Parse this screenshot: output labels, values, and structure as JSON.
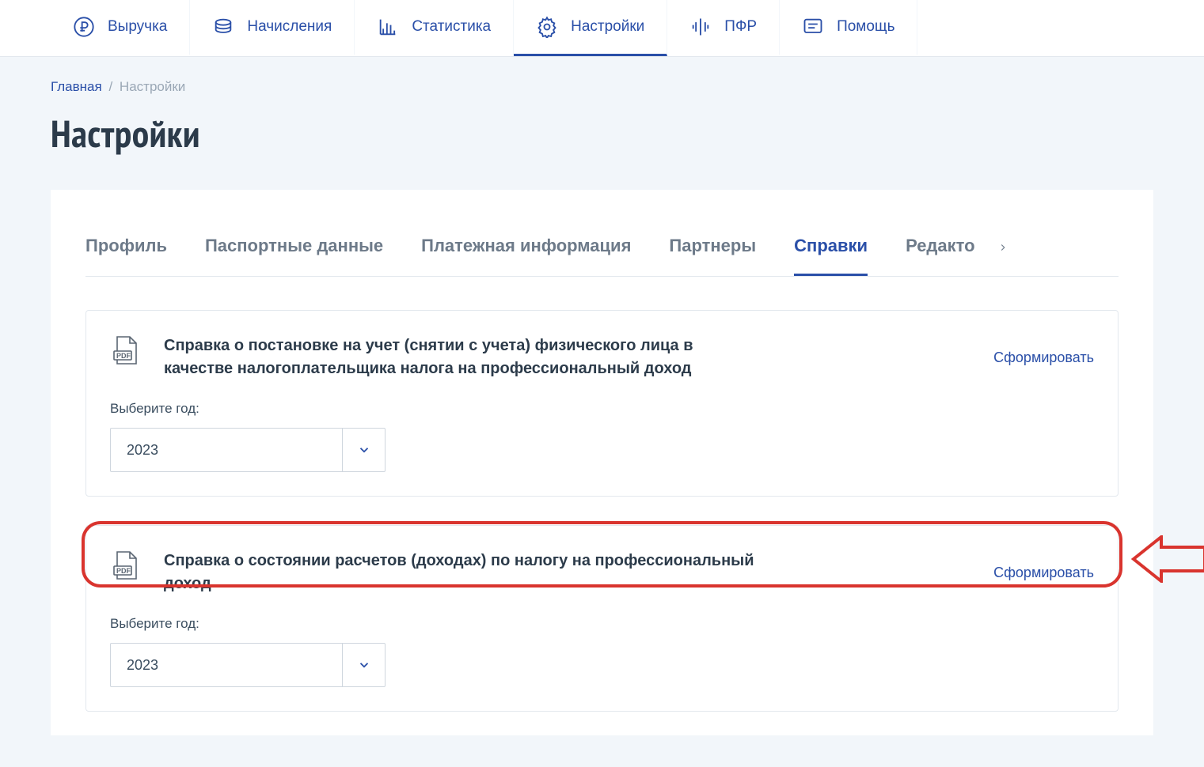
{
  "topnav": [
    {
      "label": "Выручка"
    },
    {
      "label": "Начисления"
    },
    {
      "label": "Статистика"
    },
    {
      "label": "Настройки"
    },
    {
      "label": "ПФР"
    },
    {
      "label": "Помощь"
    }
  ],
  "breadcrumb": {
    "root": "Главная",
    "current": "Настройки"
  },
  "page_title": "Настройки",
  "tabs": [
    "Профиль",
    "Паспортные данные",
    "Платежная информация",
    "Партнеры",
    "Справки",
    "Редакто"
  ],
  "docs": [
    {
      "title": "Справка о постановке на учет (снятии с учета) физического лица в качестве налогоплательщика налога на профессиональный доход",
      "action": "Сформировать",
      "year_label": "Выберите год:",
      "year_value": "2023"
    },
    {
      "title": "Справка о состоянии расчетов (доходах) по налогу на профессиональный доход",
      "action": "Сформировать",
      "year_label": "Выберите год:",
      "year_value": "2023"
    }
  ]
}
